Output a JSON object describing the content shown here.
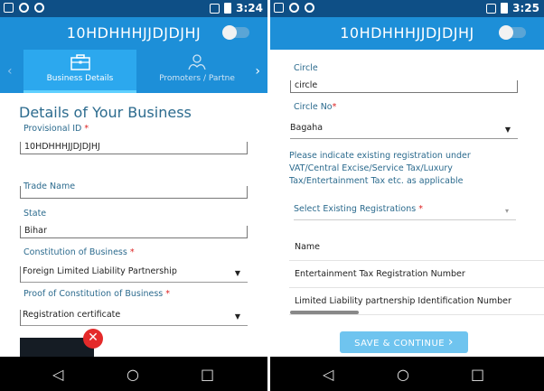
{
  "colors": {
    "statusbar": "#0e4f86",
    "appbar": "#1d8fd8",
    "active_tab": "#2ca8ee",
    "label": "#2c6b8e",
    "required": "#dd2222",
    "button": "#6fc4ef",
    "navbar": "#000000"
  },
  "left": {
    "status": {
      "time": "3:24"
    },
    "appbar": {
      "title": "10HDHHHJJDJDJHJ",
      "toggle_on": false
    },
    "tabs": [
      {
        "label": "Business Details",
        "icon": "briefcase-icon",
        "active": true
      },
      {
        "label": "Promoters / Partne",
        "icon": "people-icon",
        "active": false
      }
    ],
    "section_title": "Details of Your Business",
    "fields": {
      "provisional_id": {
        "label": "Provisional ID",
        "required_mark": "*",
        "value": "10HDHHHJJDJDJHJ"
      },
      "trade_name": {
        "label": "Trade Name",
        "value": ""
      },
      "state": {
        "label": "State",
        "value": "Bihar"
      },
      "constitution": {
        "label": "Constitution of Business",
        "required_mark": "*",
        "value": "Foreign Limited Liability Partnership"
      },
      "proof": {
        "label": "Proof of Constitution of Business",
        "required_mark": "*",
        "value": "Registration certificate"
      }
    },
    "attachment": {
      "remove_symbol": "✕"
    }
  },
  "right": {
    "status": {
      "time": "3:25"
    },
    "appbar": {
      "title": "10HDHHHJJDJDJHJ",
      "toggle_on": false
    },
    "fields": {
      "circle": {
        "label": "Circle",
        "value": "circle"
      },
      "circle_no": {
        "label": "Circle No",
        "required_mark": "*",
        "value": "Bagaha"
      }
    },
    "info_text": "Please indicate existing registration under VAT/Central Excise/Service Tax/Luxury Tax/Entertainment Tax etc. as applicable",
    "existing_reg": {
      "placeholder": "Select Existing Registrations",
      "required_mark": "*"
    },
    "list": {
      "header": "Name",
      "rows": [
        "Entertainment Tax Registration Number",
        "Limited Liability partnership Identification Number"
      ]
    },
    "save_button": "SAVE & CONTINUE",
    "save_arrow": "›"
  },
  "nav": {
    "back": "◁",
    "home": "○",
    "recents": "□"
  }
}
